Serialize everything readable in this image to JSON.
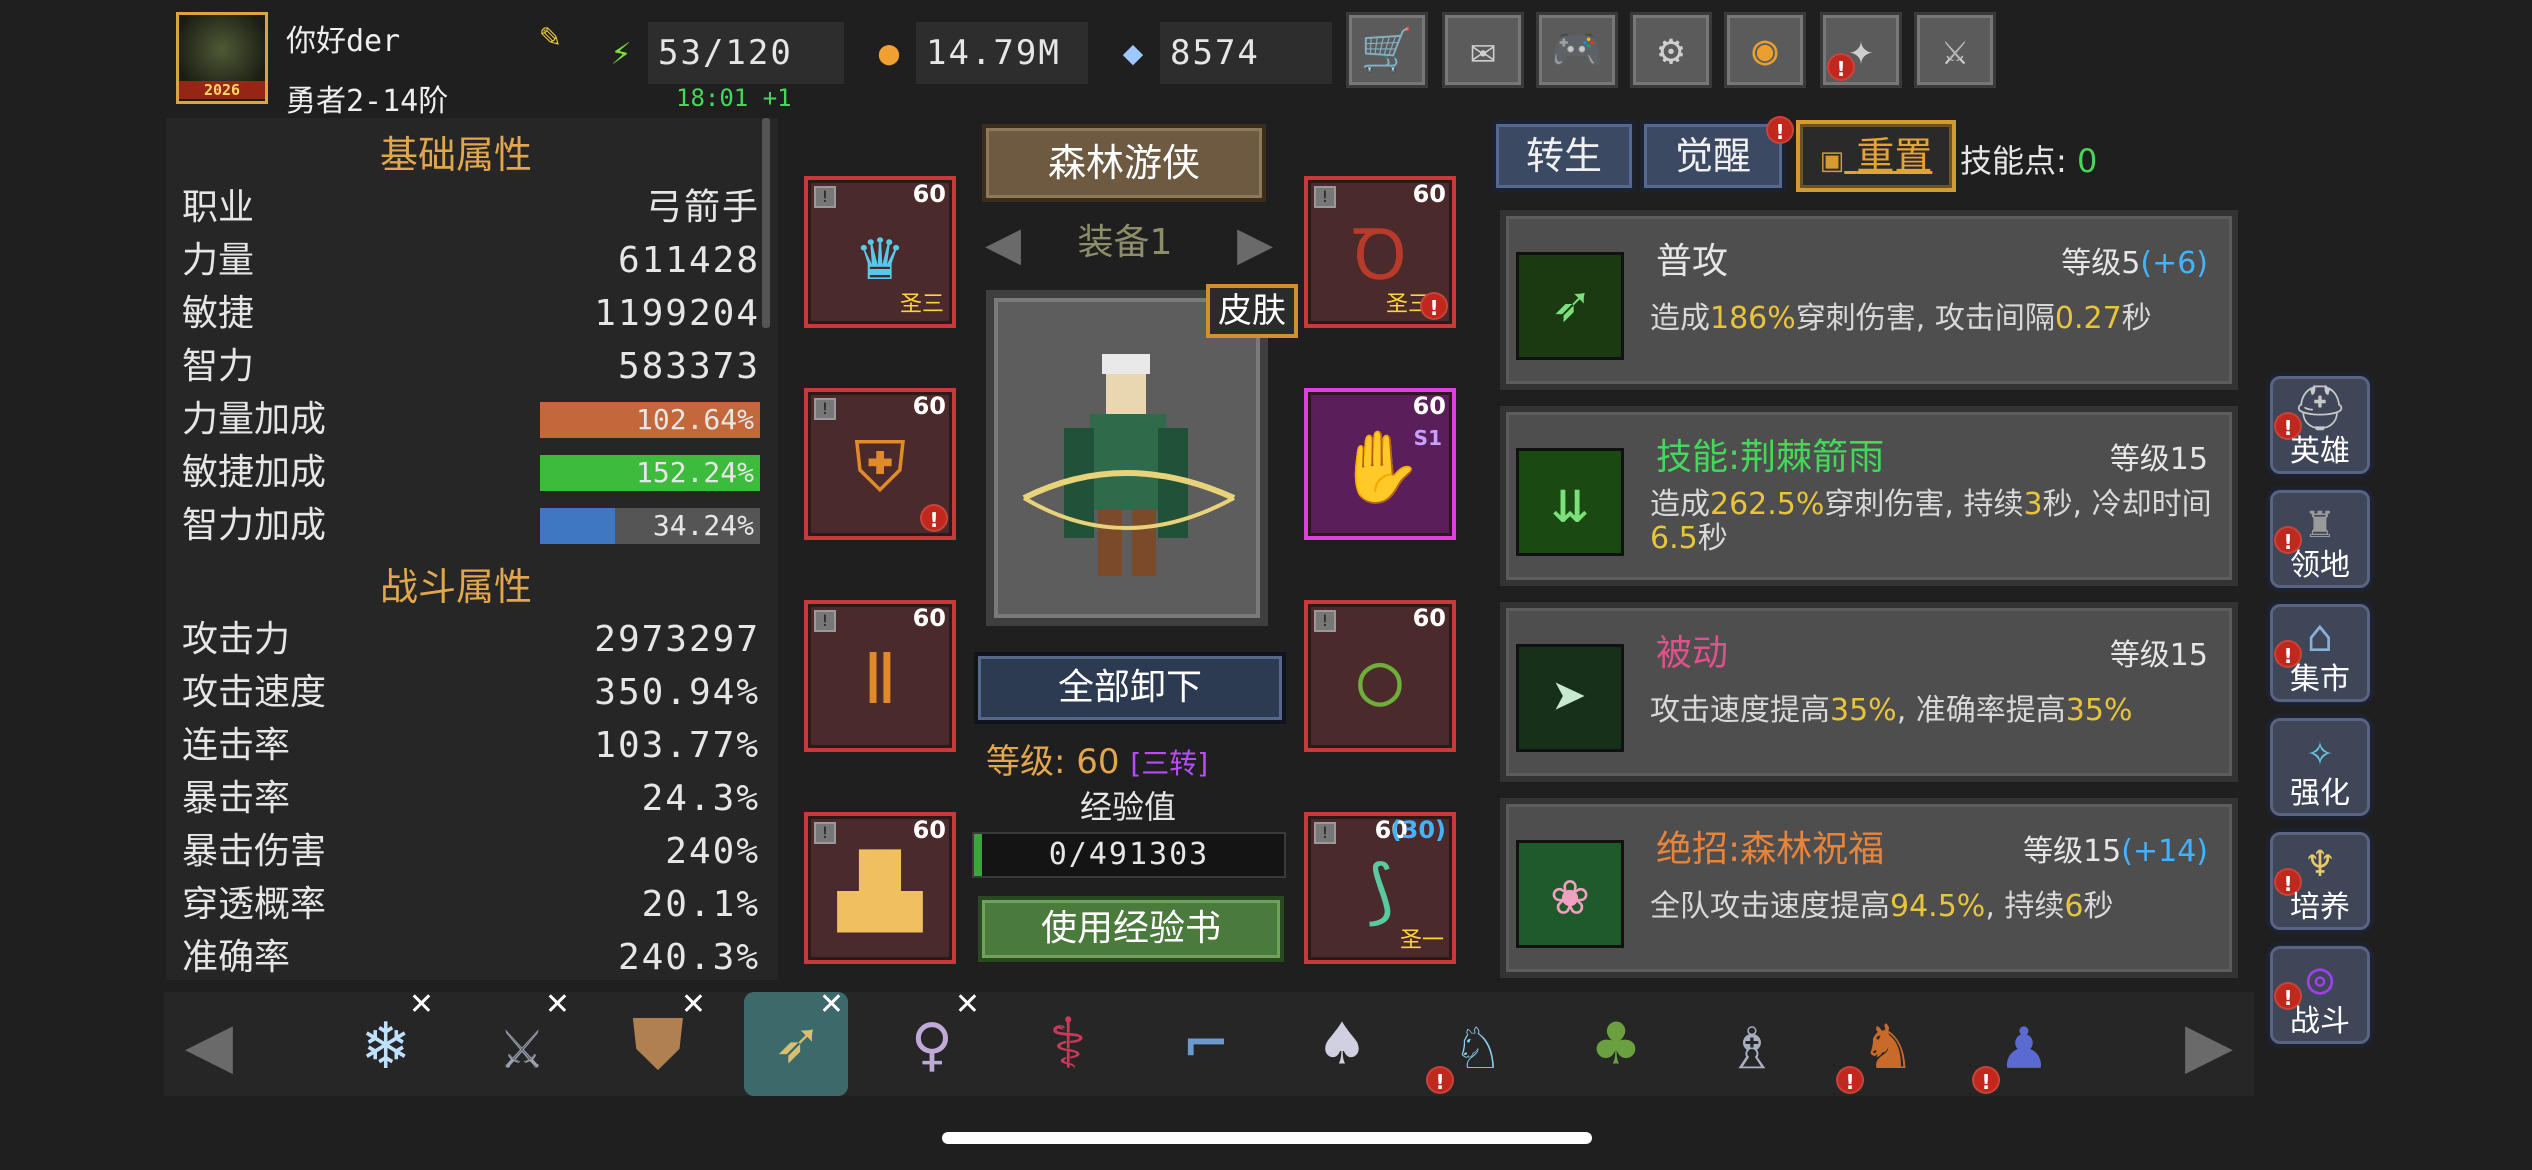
{
  "player": {
    "name": "你好der",
    "rank": "勇者2-14阶",
    "avatar_year": "2026"
  },
  "resources": {
    "stamina": "53/120",
    "stamina_timer": "18:01 +1",
    "gold": "14.79M",
    "gems": "8574"
  },
  "top_buttons": [
    "shop-cart-icon",
    "mail-icon",
    "gamepad-icon",
    "gear-icon",
    "color-wheel-icon",
    "firework-icon",
    "crossed-swords-icon"
  ],
  "attributes": {
    "basic_title": "基础属性",
    "basic": [
      {
        "label": "职业",
        "value": "弓箭手"
      },
      {
        "label": "力量",
        "value": "611428"
      },
      {
        "label": "敏捷",
        "value": "1199204"
      },
      {
        "label": "智力",
        "value": "583373"
      }
    ],
    "bonuses": [
      {
        "label": "力量加成",
        "value": "102.64%",
        "color": "#c2683a",
        "fill": 1.0
      },
      {
        "label": "敏捷加成",
        "value": "152.24%",
        "color": "#3dbb3d",
        "fill": 1.0
      },
      {
        "label": "智力加成",
        "value": "34.24%",
        "color": "#3f77c2",
        "fill": 0.34
      }
    ],
    "combat_title": "战斗属性",
    "combat": [
      {
        "label": "攻击力",
        "value": "2973297"
      },
      {
        "label": "攻击速度",
        "value": "350.94%"
      },
      {
        "label": "连击率",
        "value": "103.77%"
      },
      {
        "label": "暴击率",
        "value": "24.3%"
      },
      {
        "label": "暴击伤害",
        "value": "240%"
      },
      {
        "label": "穿透概率",
        "value": "20.1%"
      },
      {
        "label": "准确率",
        "value": "240.3%"
      }
    ]
  },
  "equipment": {
    "class_banner": "森林游侠",
    "set_tab": "装备1",
    "skin_label": "皮肤",
    "unequip_all": "全部卸下",
    "level_text": "等级: 60",
    "rebirth_text": "[三转]",
    "exp_label": "经验值",
    "exp_value": "0/491303",
    "use_exp_book": "使用经验书",
    "slots": [
      {
        "level": "60",
        "grade": "圣三"
      },
      {
        "level": "60",
        "grade": "圣三"
      },
      {
        "level": "60",
        "grade": ""
      },
      {
        "level": "60",
        "grade": "",
        "tag": "S1"
      },
      {
        "level": "60",
        "grade": ""
      },
      {
        "level": "60",
        "grade": ""
      },
      {
        "level": "60",
        "grade": ""
      },
      {
        "level": "60",
        "bonus": "(30)",
        "grade": "圣一"
      }
    ]
  },
  "skills_panel": {
    "tabs": [
      "转生",
      "觉醒",
      "重置"
    ],
    "skill_points_label": "技能点:",
    "skill_points": "0",
    "skills": [
      {
        "name": "普攻",
        "name_color": "#e6e6e6",
        "level": "等级5",
        "bonus": "(+6)",
        "desc_parts": [
          "造成",
          "186%",
          "穿刺伤害, 攻击间隔",
          "0.27",
          "秒"
        ]
      },
      {
        "name": "技能:荆棘箭雨",
        "name_color": "#44d85a",
        "level": "等级15",
        "bonus": "",
        "desc_parts": [
          "造成",
          "262.5%",
          "穿刺伤害, 持续",
          "3",
          "秒, 冷却时间",
          "6.5",
          "秒"
        ]
      },
      {
        "name": "被动",
        "name_color": "#e0508a",
        "level": "等级15",
        "bonus": "",
        "desc_parts": [
          "攻击速度提高",
          "35%",
          ", 准确率提高",
          "35%"
        ]
      },
      {
        "name": "绝招:森林祝福",
        "name_color": "#e8843a",
        "level": "等级15",
        "bonus": "(+14)",
        "desc_parts": [
          "全队攻击速度提高",
          "94.5%",
          ", 持续",
          "6",
          "秒"
        ]
      }
    ]
  },
  "side_menu": [
    "英雄",
    "领地",
    "集市",
    "强化",
    "培养",
    "战斗"
  ],
  "hero_bar": {
    "heroes": [
      {
        "icon": "ice-mage",
        "removable": true
      },
      {
        "icon": "swordsman",
        "removable": true
      },
      {
        "icon": "warrior",
        "removable": true
      },
      {
        "icon": "forest-ranger",
        "removable": true,
        "selected": true
      },
      {
        "icon": "dancer",
        "removable": true
      },
      {
        "icon": "priestess",
        "removable": false
      },
      {
        "icon": "gunner",
        "removable": false
      },
      {
        "icon": "vampire",
        "removable": false
      },
      {
        "icon": "frost-knight",
        "removable": false,
        "alert": true
      },
      {
        "icon": "druid",
        "removable": false
      },
      {
        "icon": "paladin",
        "removable": false
      },
      {
        "icon": "beast",
        "removable": false,
        "alert": true
      },
      {
        "icon": "assassin",
        "removable": false,
        "alert": true
      }
    ]
  }
}
